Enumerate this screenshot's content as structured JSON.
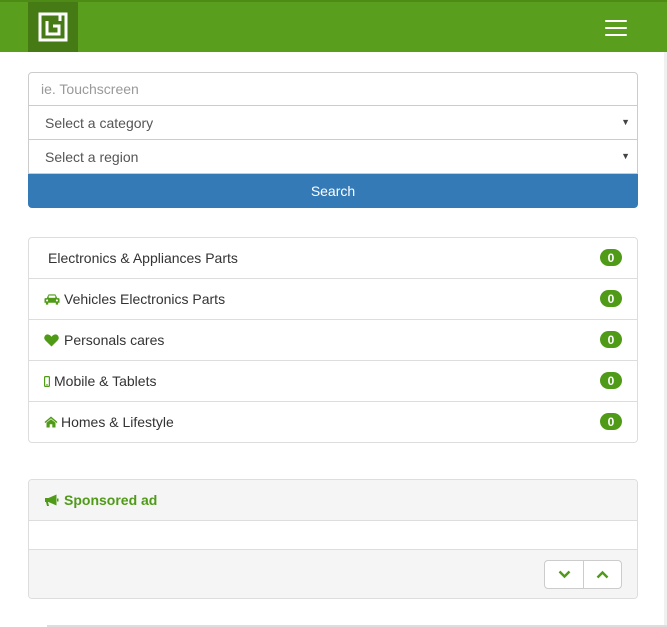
{
  "colors": {
    "brand_green": "#5a9e1e",
    "logo_dark_green": "#467a14",
    "primary_blue": "#337ab7",
    "badge_green": "#4f9a17"
  },
  "navbar": {
    "logo_icon": "g-logo-icon",
    "menu_icon": "hamburger-menu-icon"
  },
  "search": {
    "keyword_placeholder": "ie. Touchscreen",
    "category_select": "Select a category",
    "region_select": "Select a region",
    "button_label": "Search"
  },
  "categories": [
    {
      "label": "Electronics & Appliances Parts",
      "count": "0",
      "icon": ""
    },
    {
      "label": "Vehicles Electronics Parts",
      "count": "0",
      "icon": "car-icon"
    },
    {
      "label": "Personals cares",
      "count": "0",
      "icon": "heart-icon"
    },
    {
      "label": "Mobile & Tablets",
      "count": "0",
      "icon": "mobile-icon"
    },
    {
      "label": "Homes & Lifestyle",
      "count": "0",
      "icon": "home-icon"
    }
  ],
  "ad": {
    "header_icon": "bullhorn-icon",
    "title": "Sponsored ad",
    "prev_icon": "chevron-down-icon",
    "next_icon": "chevron-up-icon"
  }
}
